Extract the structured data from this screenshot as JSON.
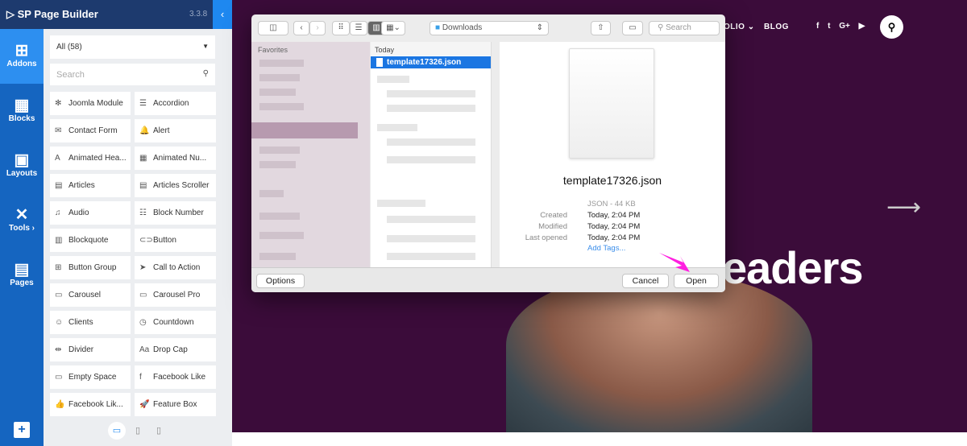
{
  "builder": {
    "title": "SP Page Builder",
    "version": "3.3.8",
    "nav": [
      {
        "label": "Addons",
        "icon": "add-square-icon"
      },
      {
        "label": "Blocks",
        "icon": "blocks-icon"
      },
      {
        "label": "Layouts",
        "icon": "layouts-icon"
      },
      {
        "label": "Tools ›",
        "icon": "tools-icon"
      },
      {
        "label": "Pages",
        "icon": "pages-icon"
      }
    ],
    "filter": "All (58)",
    "search_placeholder": "Search",
    "addons": [
      {
        "label": "Joomla Module",
        "icon": "✻"
      },
      {
        "label": "Accordion",
        "icon": "☰"
      },
      {
        "label": "Contact Form",
        "icon": "✉"
      },
      {
        "label": "Alert",
        "icon": "🔔"
      },
      {
        "label": "Animated Hea...",
        "icon": "A"
      },
      {
        "label": "Animated Nu...",
        "icon": "▦"
      },
      {
        "label": "Articles",
        "icon": "▤"
      },
      {
        "label": "Articles Scroller",
        "icon": "▤"
      },
      {
        "label": "Audio",
        "icon": "♫"
      },
      {
        "label": "Block Number",
        "icon": "☷"
      },
      {
        "label": "Blockquote",
        "icon": "▥"
      },
      {
        "label": "Button",
        "icon": "⊂⊃"
      },
      {
        "label": "Button Group",
        "icon": "⊞"
      },
      {
        "label": "Call to Action",
        "icon": "➤"
      },
      {
        "label": "Carousel",
        "icon": "▭"
      },
      {
        "label": "Carousel Pro",
        "icon": "▭"
      },
      {
        "label": "Clients",
        "icon": "☺"
      },
      {
        "label": "Countdown",
        "icon": "◷"
      },
      {
        "label": "Divider",
        "icon": "⇹"
      },
      {
        "label": "Drop Cap",
        "icon": "Aa"
      },
      {
        "label": "Empty Space",
        "icon": "▭"
      },
      {
        "label": "Facebook Like",
        "icon": "f"
      },
      {
        "label": "Facebook Lik...",
        "icon": "👍"
      },
      {
        "label": "Feature Box",
        "icon": "🚀"
      }
    ]
  },
  "site": {
    "menu": [
      "OLIO ⌄",
      "BLOG"
    ],
    "social": [
      "f",
      "t",
      "G+",
      "▶"
    ],
    "headline": "eaders"
  },
  "dialog": {
    "location": "Downloads",
    "search_placeholder": "Search",
    "sidebar_header": "Favorites",
    "column_header": "Today",
    "selected_file": "template17326.json",
    "preview": {
      "filename": "template17326.json",
      "kind": "JSON - 44 KB",
      "created_label": "Created",
      "created": "Today, 2:04 PM",
      "modified_label": "Modified",
      "modified": "Today, 2:04 PM",
      "opened_label": "Last opened",
      "opened": "Today, 2:04 PM",
      "add_tags": "Add Tags..."
    },
    "options": "Options",
    "cancel": "Cancel",
    "open": "Open"
  },
  "colors": {
    "site_bg": "#3b0c3a",
    "builder_nav": "#1565c0",
    "selection": "#1b76e2",
    "pointer": "#ff1ee0"
  }
}
